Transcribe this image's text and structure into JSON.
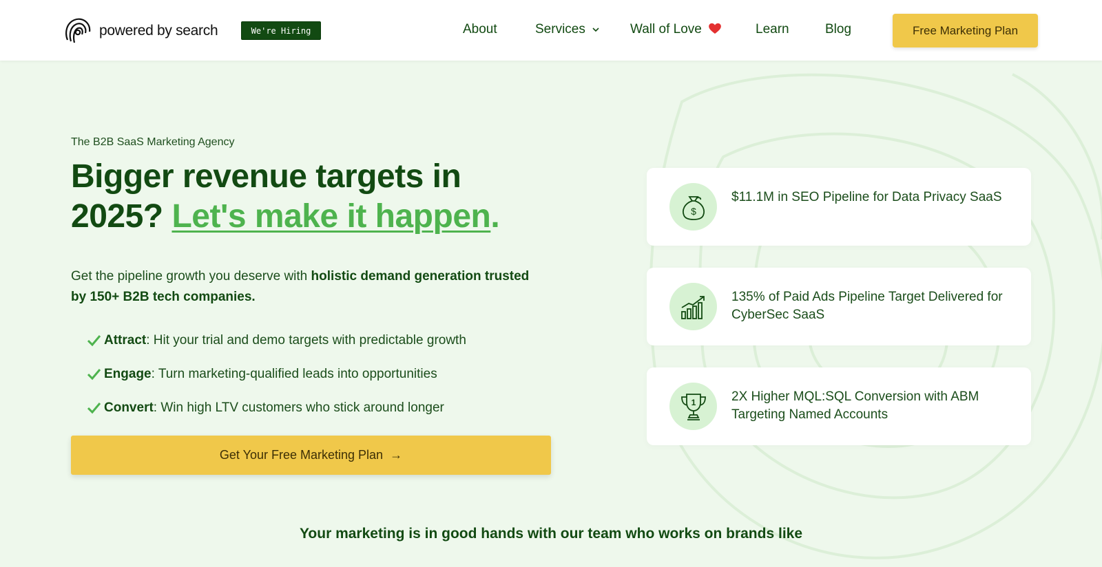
{
  "header": {
    "logo_text": "powered by search",
    "hiring_badge": "We're Hiring",
    "nav": [
      {
        "label": "About"
      },
      {
        "label": "Services"
      },
      {
        "label": "Wall of Love"
      },
      {
        "label": "Learn"
      },
      {
        "label": "Blog"
      }
    ],
    "cta_label": "Free Marketing Plan"
  },
  "hero": {
    "eyebrow": "The B2B SaaS Marketing Agency",
    "headline_part1": "Bigger revenue targets in 2025?",
    "headline_highlight": "Let's make it happen",
    "headline_end": ".",
    "lead_plain": "Get the pipeline growth you deserve with",
    "lead_bold": "holistic demand generation trusted by 150+ B2B tech companies.",
    "checks": [
      {
        "title": "Attract",
        "text": ": Hit your trial and demo targets with predictable growth"
      },
      {
        "title": "Engage",
        "text": ": Turn marketing-qualified leads into opportunities"
      },
      {
        "title": "Convert",
        "text": ": Win high LTV customers who stick around longer"
      }
    ],
    "cta_label": "Get Your Free Marketing Plan",
    "cta_arrow": "→"
  },
  "cards": [
    {
      "icon": "money-bag-icon",
      "text": "$11.1M in SEO Pipeline for Data Privacy SaaS"
    },
    {
      "icon": "growth-chart-icon",
      "text": "135% of Paid Ads Pipeline Target Delivered for CyberSec SaaS"
    },
    {
      "icon": "trophy-icon",
      "text": "2X Higher MQL:SQL Conversion with ABM Targeting Named Accounts"
    }
  ],
  "tagline": "Your marketing is in good hands with our team who works on brands like",
  "colors": {
    "brand_green": "#124a12",
    "accent_green": "#4eb34e",
    "cta_yellow": "#f0c84a",
    "background": "#eef8ec",
    "icon_circle": "#d7f2d3"
  }
}
